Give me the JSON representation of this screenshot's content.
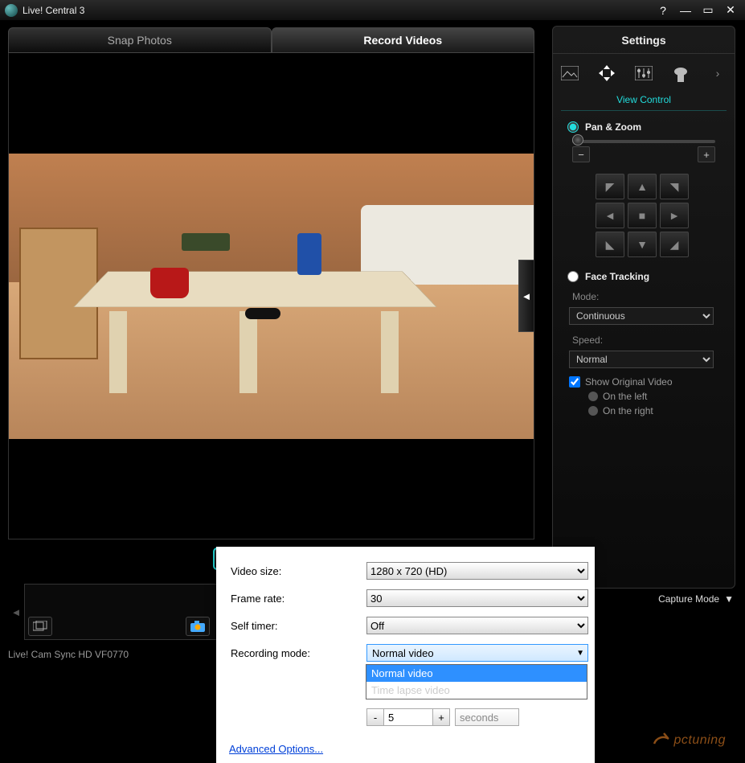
{
  "titlebar": {
    "title": "Live! Central 3"
  },
  "tabs": {
    "snap": "Snap Photos",
    "record": "Record Videos"
  },
  "settings": {
    "header": "Settings",
    "section_view_control": "View Control",
    "pan_zoom_label": "Pan & Zoom",
    "zoom_minus": "−",
    "zoom_plus": "+",
    "face_tracking_label": "Face Tracking",
    "mode_label": "Mode:",
    "mode_value": "Continuous",
    "speed_label": "Speed:",
    "speed_value": "Normal",
    "show_original_label": "Show Original Video",
    "on_left_label": "On the left",
    "on_right_label": "On the right"
  },
  "popup": {
    "video_size_label": "Video size:",
    "video_size_value": "1280 x 720 (HD)",
    "frame_rate_label": "Frame rate:",
    "frame_rate_value": "30",
    "self_timer_label": "Self timer:",
    "self_timer_value": "Off",
    "recording_mode_label": "Recording mode:",
    "recording_mode_value": "Normal video",
    "opt_normal": "Normal video",
    "opt_timelapse": "Time lapse video",
    "step_value": "5",
    "step_unit": "seconds",
    "advanced_link": "Advanced Options..."
  },
  "status": {
    "device": "Live! Cam Sync HD VF0770",
    "capture_mode": "Capture Mode"
  },
  "collapse_glyph": "◄",
  "dropdown_glyph": "▼",
  "watermark": "pctuning"
}
